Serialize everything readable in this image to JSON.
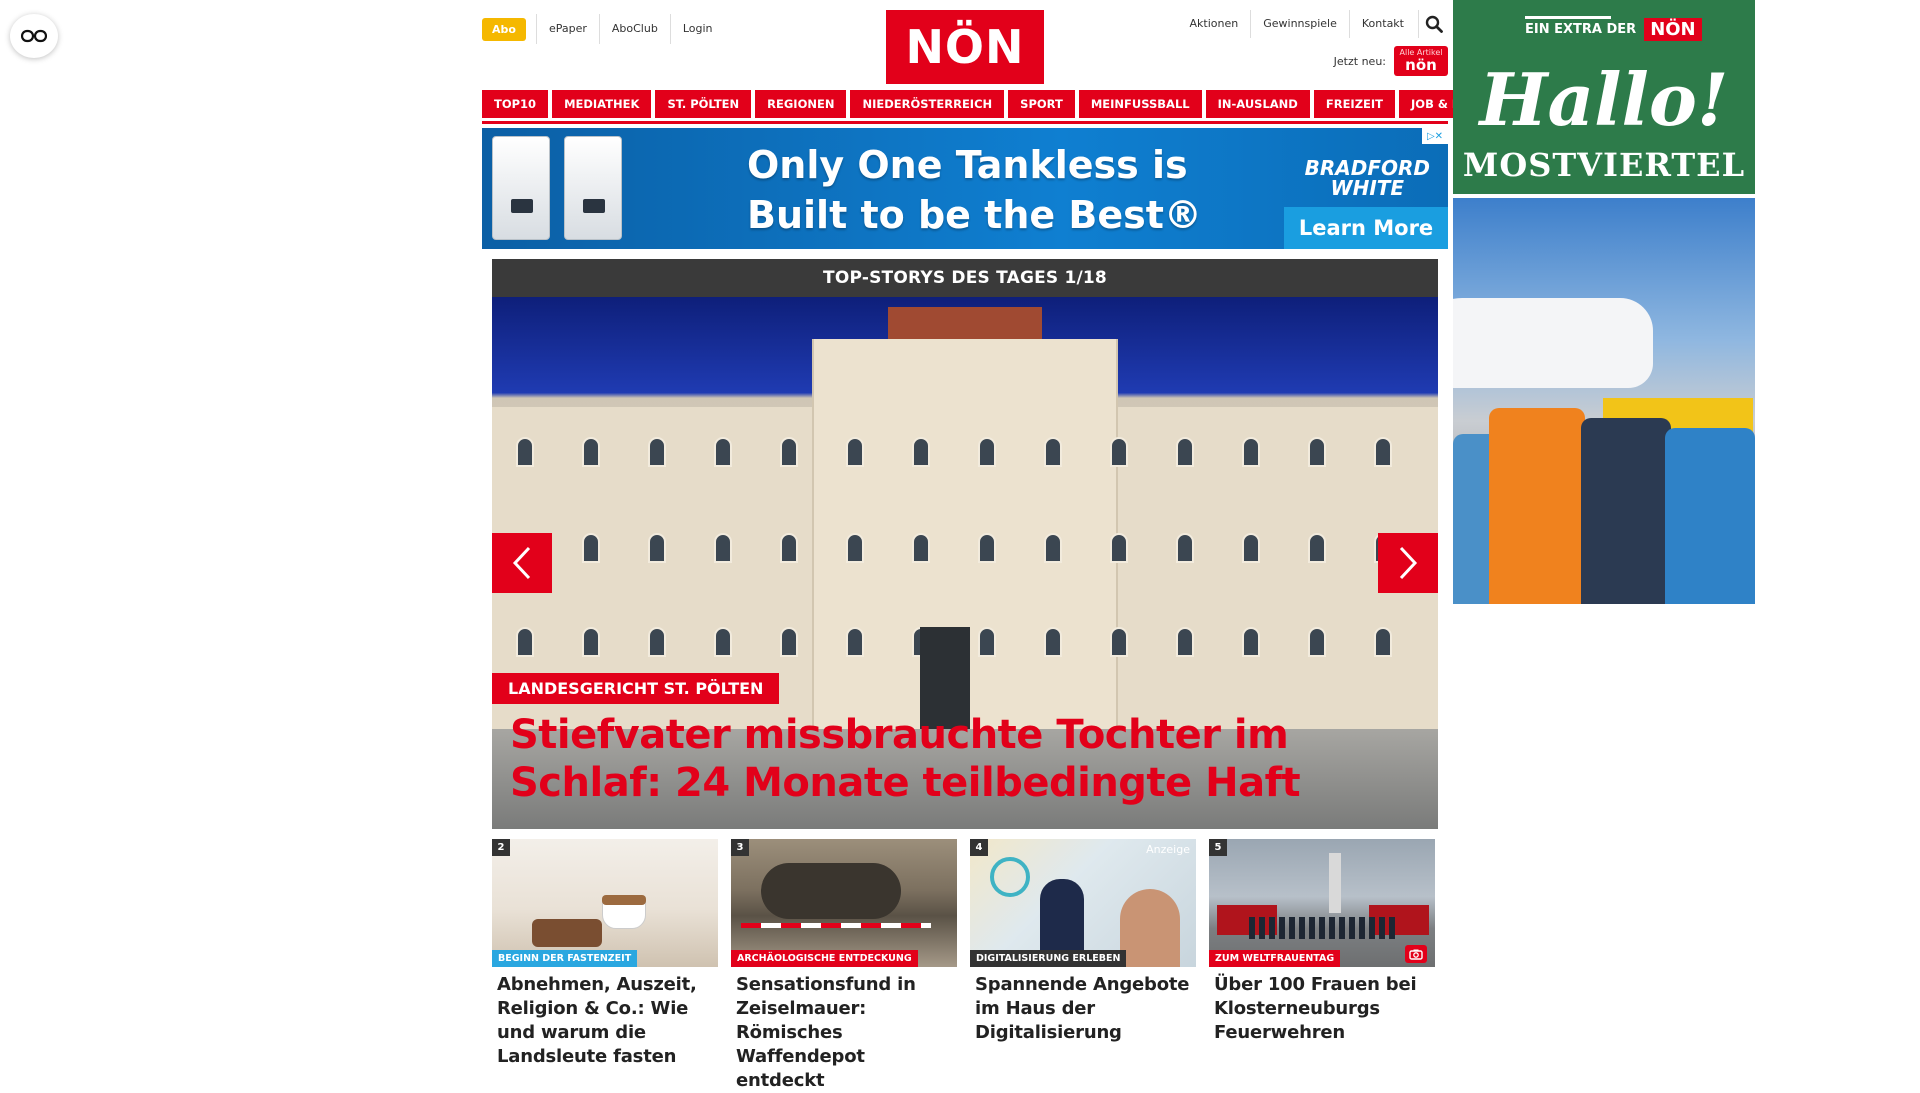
{
  "header": {
    "abo_label": "Abo",
    "left_links": [
      "ePaper",
      "AboClub",
      "Login"
    ],
    "logo_text": "NÖN",
    "right_links": [
      "Aktionen",
      "Gewinnspiele",
      "Kontakt"
    ],
    "jetzt_label": "Jetzt neu:",
    "app_badge_small": "Alle Artikel",
    "app_badge_text": "nön"
  },
  "nav": {
    "items": [
      "TOP10",
      "MEDIATHEK",
      "ST. PÖLTEN",
      "REGIONEN",
      "NIEDERÖSTERREICH",
      "SPORT",
      "MEINFUSSBALL",
      "IN-AUSLAND",
      "FREIZEIT",
      "JOB & KARRIERE"
    ]
  },
  "ad_banner": {
    "headline_line1": "Only One Tankless is",
    "headline_line2": "Built to be the Best®",
    "brand_line1": "BRADFORD",
    "brand_line2": "WHITE",
    "cta": "Learn More"
  },
  "slider": {
    "header": "TOP-STORYS DES TAGES 1/18",
    "kicker": "LANDESGERICHT ST. PÖLTEN",
    "headline": "Stiefvater missbrauchte Tochter im Schlaf: 24 Monate teilbedingte Haft"
  },
  "teasers": [
    {
      "num": "2",
      "tag": "Beginn der Fastenzeit",
      "tag_color": "#2aa7e0",
      "title": "Abnehmen, Auszeit, Religion & Co.: Wie und warum die Landsleute fasten"
    },
    {
      "num": "3",
      "tag": "Archäologische Entdeckung",
      "tag_color": "#e2001a",
      "title": "Sensationsfund in Zeiselmauer: Römisches Waffendepot entdeckt"
    },
    {
      "num": "4",
      "tag": "Digitalisierung erleben",
      "tag_color": "#333333",
      "anzeige": "Anzeige",
      "title": "Spannende Angebote im Haus der Digitalisierung"
    },
    {
      "num": "5",
      "tag": "Zum Weltfrauentag",
      "tag_color": "#e2001a",
      "title": "Über 100 Frauen bei Klosterneuburgs Feuerwehren"
    }
  ],
  "side_ad": {
    "extra_label": "EIN EXTRA DER",
    "noen": "NÖN",
    "hallo": "Hallo!",
    "region": "MOSTVIERTEL"
  },
  "colors": {
    "brand_red": "#e2001a",
    "abo_yellow": "#f5b800",
    "side_green": "#2d7b4a"
  },
  "icons": [
    "reader-mode-icon",
    "search-icon",
    "chevron-left-icon",
    "chevron-right-icon",
    "camera-icon",
    "ad-choices-icon"
  ]
}
